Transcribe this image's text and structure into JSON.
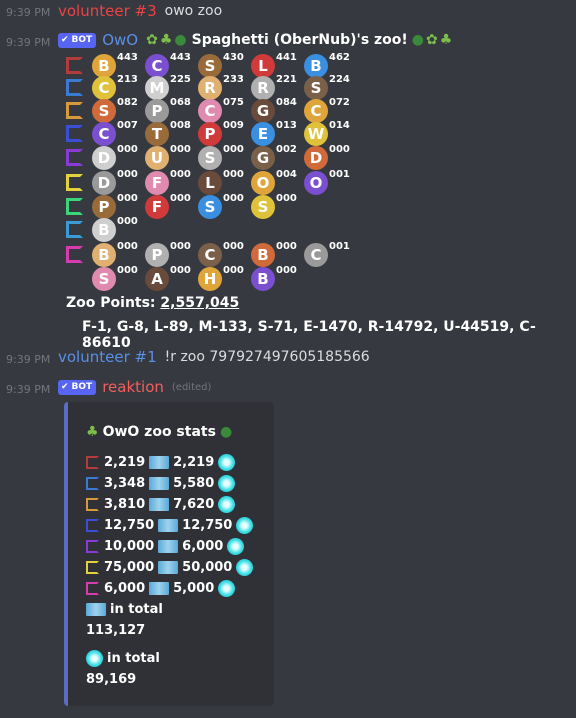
{
  "messages": [
    {
      "time": "9:39 PM",
      "author": "volunteer #3",
      "text": "owo zoo"
    },
    {
      "time": "9:39 PM",
      "author": "OwO",
      "bot_label": "BOT",
      "title": "Spaghetti (OberNub)'s zoo!"
    },
    {
      "time": "9:39 PM",
      "author": "volunteer #1",
      "text": "!r zoo 797927497605185566"
    },
    {
      "time": "9:39 PM",
      "author": "reaktion",
      "bot_label": "BOT",
      "edited": "(edited)"
    }
  ],
  "colors": {
    "volunteer3": "#ed4245",
    "owo": "#5a8fe6",
    "volunteer1": "#5a8fe6",
    "reaktion": "#f25f5c",
    "bot": "#5865f2"
  },
  "zoo": {
    "tiers": [
      {
        "letter": "C",
        "color": "#b23b3b"
      },
      {
        "letter": "U",
        "color": "#3b7bd6"
      },
      {
        "letter": "R",
        "color": "#d69a3b"
      },
      {
        "letter": "E",
        "color": "#3b4fd6"
      },
      {
        "letter": "M",
        "color": "#8a3bd6"
      },
      {
        "letter": "L",
        "color": "#e3d23b"
      },
      {
        "letter": "G",
        "color": "#3bd67a"
      },
      {
        "letter": "F",
        "color": "#3b9bd6"
      },
      {
        "letter": "S",
        "color": "#d63bb0"
      }
    ],
    "rows": [
      [
        {
          "icon": "bee",
          "count": "443"
        },
        {
          "icon": "caterpillar",
          "count": "443"
        },
        {
          "icon": "snail",
          "count": "430"
        },
        {
          "icon": "ladybug",
          "count": "441"
        },
        {
          "icon": "butterfly",
          "count": "462"
        }
      ],
      [
        {
          "icon": "chick",
          "count": "213"
        },
        {
          "icon": "mouse",
          "count": "225"
        },
        {
          "icon": "rooster",
          "count": "233"
        },
        {
          "icon": "rabbit",
          "count": "221"
        },
        {
          "icon": "squirrel",
          "count": "224"
        }
      ],
      [
        {
          "icon": "sheep",
          "count": "082"
        },
        {
          "icon": "pig",
          "count": "068"
        },
        {
          "icon": "cow",
          "count": "075"
        },
        {
          "icon": "goat",
          "count": "084"
        },
        {
          "icon": "cat",
          "count": "072"
        }
      ],
      [
        {
          "icon": "crocodile",
          "count": "007"
        },
        {
          "icon": "tiger",
          "count": "008"
        },
        {
          "icon": "penguin",
          "count": "009"
        },
        {
          "icon": "elephant",
          "count": "013"
        },
        {
          "icon": "whale",
          "count": "014"
        }
      ],
      [
        {
          "icon": "dragon",
          "count": "000"
        },
        {
          "icon": "unicorn",
          "count": "000"
        },
        {
          "icon": "snowman",
          "count": "000"
        },
        {
          "icon": "ghost",
          "count": "002"
        },
        {
          "icon": "dove",
          "count": "000"
        }
      ],
      [
        {
          "icon": "deer",
          "count": "000"
        },
        {
          "icon": "fox",
          "count": "000"
        },
        {
          "icon": "lion",
          "count": "000"
        },
        {
          "icon": "owl",
          "count": "004"
        },
        {
          "icon": "octopus",
          "count": "001"
        }
      ],
      [
        {
          "icon": "plant",
          "count": "000"
        },
        {
          "icon": "frog",
          "count": "000"
        },
        {
          "icon": "shrimp",
          "count": "000"
        },
        {
          "icon": "spider",
          "count": "000"
        }
      ],
      [
        {
          "icon": "blob",
          "count": "000"
        }
      ],
      [
        {
          "icon": "bunny",
          "count": "000"
        },
        {
          "icon": "pumpkin",
          "count": "000"
        },
        {
          "icon": "cookie",
          "count": "000"
        },
        {
          "icon": "box",
          "count": "000"
        },
        {
          "icon": "critter",
          "count": "001"
        }
      ],
      [
        {
          "icon": "shell",
          "count": "000"
        },
        {
          "icon": "alien",
          "count": "000"
        },
        {
          "icon": "heart",
          "count": "000"
        },
        {
          "icon": "bear",
          "count": "000"
        }
      ]
    ],
    "points_label": "Zoo Points:",
    "points": "2,557,045",
    "stats": "F-1, G-8, L-89, M-133, S-71, E-1470, R-14792, U-44519, C-86610"
  },
  "embed": {
    "title": "OwO zoo stats",
    "rows": [
      {
        "tier": "C",
        "color": "#b23b3b",
        "a": "2,219",
        "b": "2,219"
      },
      {
        "tier": "U",
        "color": "#3b7bd6",
        "a": "3,348",
        "b": "5,580"
      },
      {
        "tier": "R",
        "color": "#d69a3b",
        "a": "3,810",
        "b": "7,620"
      },
      {
        "tier": "E",
        "color": "#3b4fd6",
        "a": "12,750",
        "b": "12,750"
      },
      {
        "tier": "M",
        "color": "#8a3bd6",
        "a": "10,000",
        "b": "6,000"
      },
      {
        "tier": "L",
        "color": "#e3d23b",
        "a": "75,000",
        "b": "50,000"
      },
      {
        "tier": "S",
        "color": "#d63bb0",
        "a": "6,000",
        "b": "5,000"
      }
    ],
    "total_label_1": "in total",
    "total_1": "113,127",
    "total_label_2": "in total",
    "total_2": "89,169"
  }
}
